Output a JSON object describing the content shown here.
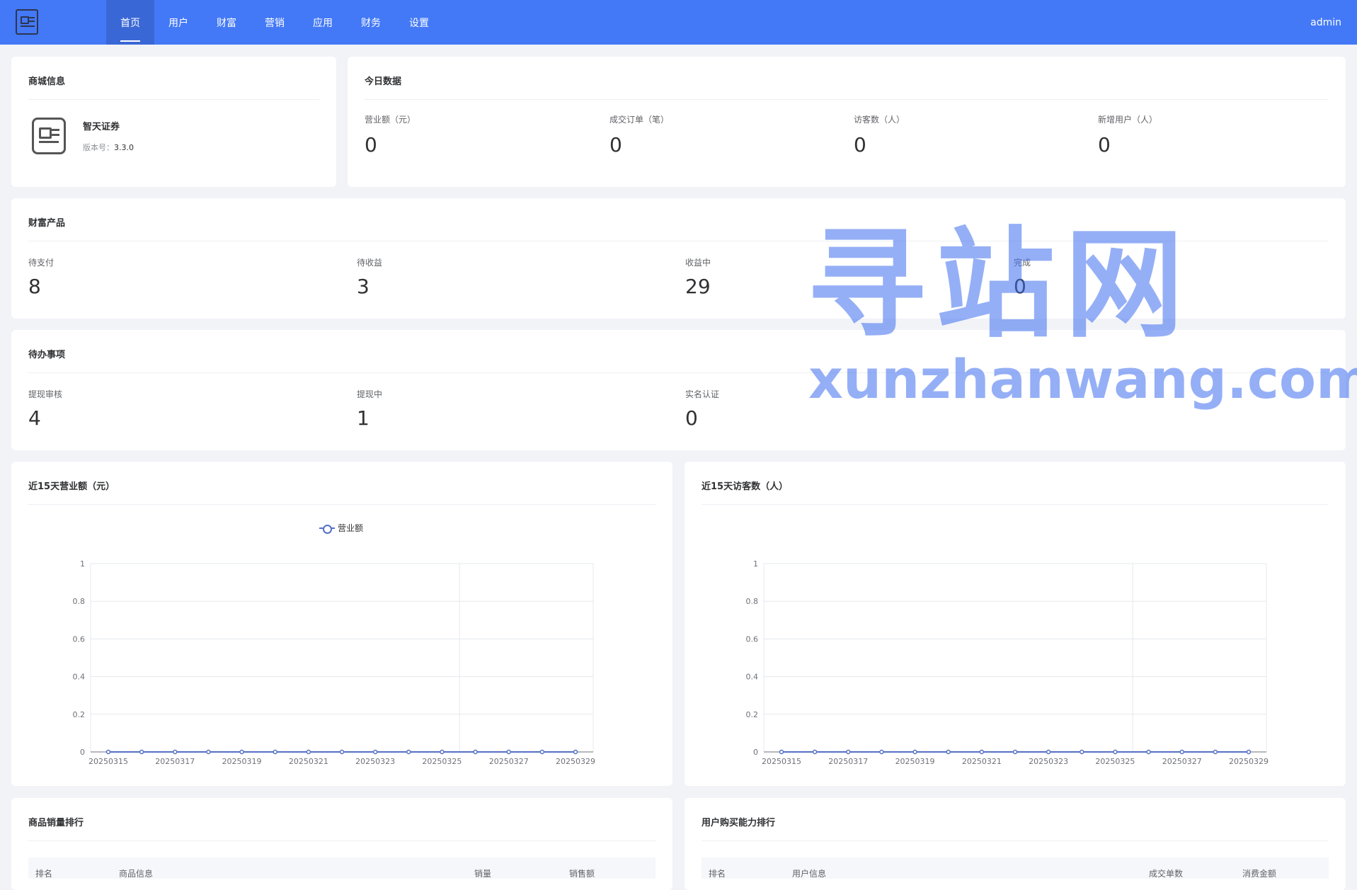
{
  "header": {
    "nav": [
      "首页",
      "用户",
      "财富",
      "营销",
      "应用",
      "财务",
      "设置"
    ],
    "active_index": 0,
    "user": "admin"
  },
  "shop": {
    "title": "商城信息",
    "name": "智天证券",
    "version_label": "版本号：",
    "version": "3.3.0"
  },
  "today": {
    "title": "今日数据",
    "stats": [
      {
        "label": "营业额（元）",
        "value": "0"
      },
      {
        "label": "成交订单（笔）",
        "value": "0"
      },
      {
        "label": "访客数（人）",
        "value": "0"
      },
      {
        "label": "新增用户（人）",
        "value": "0"
      }
    ]
  },
  "wealth": {
    "title": "财富产品",
    "stats": [
      {
        "label": "待支付",
        "value": "8"
      },
      {
        "label": "待收益",
        "value": "3"
      },
      {
        "label": "收益中",
        "value": "29"
      },
      {
        "label": "完成",
        "value": "0"
      }
    ]
  },
  "todo": {
    "title": "待办事项",
    "stats": [
      {
        "label": "提现审核",
        "value": "4"
      },
      {
        "label": "提现中",
        "value": "1"
      },
      {
        "label": "实名认证",
        "value": "0"
      }
    ]
  },
  "revenue_chart": {
    "title": "近15天营业额（元）",
    "legend": "营业额"
  },
  "visitor_chart": {
    "title": "近15天访客数（人）"
  },
  "chart_data": [
    {
      "type": "line",
      "title": "",
      "x": [
        "20250315",
        "20250316",
        "20250317",
        "20250318",
        "20250319",
        "20250320",
        "20250321",
        "20250322",
        "20250323",
        "20250324",
        "20250325",
        "20250326",
        "20250327",
        "20250328",
        "20250329"
      ],
      "x_tick_labels": [
        "20250315",
        "20250317",
        "20250319",
        "20250321",
        "20250323",
        "20250325",
        "20250327",
        "20250329"
      ],
      "series": [
        {
          "name": "营业额",
          "values": [
            0,
            0,
            0,
            0,
            0,
            0,
            0,
            0,
            0,
            0,
            0,
            0,
            0,
            0,
            0
          ]
        }
      ],
      "ylim": [
        0,
        1
      ],
      "y_ticks": [
        "0",
        "0.2",
        "0.4",
        "0.6",
        "0.8",
        "1"
      ],
      "grid": true,
      "legend": "top-center",
      "color": "#5470c6"
    },
    {
      "type": "line",
      "title": "",
      "x": [
        "20250315",
        "20250316",
        "20250317",
        "20250318",
        "20250319",
        "20250320",
        "20250321",
        "20250322",
        "20250323",
        "20250324",
        "20250325",
        "20250326",
        "20250327",
        "20250328",
        "20250329"
      ],
      "x_tick_labels": [
        "20250315",
        "20250317",
        "20250319",
        "20250321",
        "20250323",
        "20250325",
        "20250327",
        "20250329"
      ],
      "series": [
        {
          "values": [
            0,
            0,
            0,
            0,
            0,
            0,
            0,
            0,
            0,
            0,
            0,
            0,
            0,
            0,
            0
          ]
        }
      ],
      "ylim": [
        0,
        1
      ],
      "y_ticks": [
        "0",
        "0.2",
        "0.4",
        "0.6",
        "0.8",
        "1"
      ],
      "grid": true,
      "color": "#5470c6"
    }
  ],
  "product_rank": {
    "title": "商品销量排行",
    "columns": [
      "排名",
      "商品信息",
      "销量",
      "销售额"
    ]
  },
  "user_rank": {
    "title": "用户购买能力排行",
    "columns": [
      "排名",
      "用户信息",
      "成交单数",
      "消费金额"
    ]
  },
  "watermark": {
    "cn": "寻站网",
    "en": "xunzhanwang.com"
  }
}
